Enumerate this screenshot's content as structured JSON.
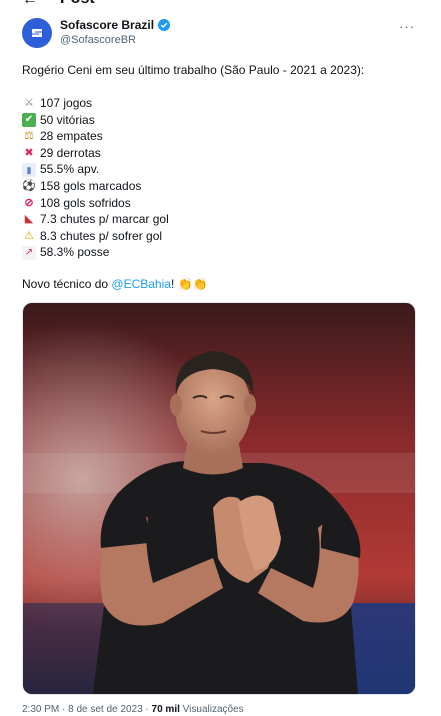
{
  "header": {
    "title": "Post",
    "back_glyph": "←"
  },
  "tweet": {
    "author_name": "Sofascore Brazil",
    "author_handle": "@SofascoreBR",
    "more_glyph": "···",
    "intro": "Rogério Ceni em seu último trabalho (São Paulo - 2021 a 2023):",
    "stats": [
      {
        "icon": "swords-icon",
        "text": "107 jogos"
      },
      {
        "icon": "check-icon",
        "text": "50 vitórias"
      },
      {
        "icon": "scales-icon",
        "text": "28 empates"
      },
      {
        "icon": "cross-mark-icon",
        "text": "29 derrotas"
      },
      {
        "icon": "bar-chart-icon",
        "text": "55.5% apv."
      },
      {
        "icon": "soccer-ball-icon",
        "text": "158 gols marcados"
      },
      {
        "icon": "prohibited-icon",
        "text": "108 gols sofridos"
      },
      {
        "icon": "soccer-shoe-icon",
        "text": "7.3 chutes p/ marcar gol"
      },
      {
        "icon": "warning-icon",
        "text": "8.3 chutes p/ sofrer gol"
      },
      {
        "icon": "trending-up-icon",
        "text": "58.3% posse"
      }
    ],
    "outro_prefix": "Novo técnico do ",
    "outro_link": "@ECBahia",
    "outro_suffix": "! 👏👏",
    "timestamp": "2:30 PM · 8 de set de 2023 · ",
    "views_count": "70 mil",
    "views_label": " Visualizações"
  },
  "colors": {
    "brand_blue": "#2c5fd8",
    "link": "#1d9bf0",
    "muted": "#536471"
  }
}
